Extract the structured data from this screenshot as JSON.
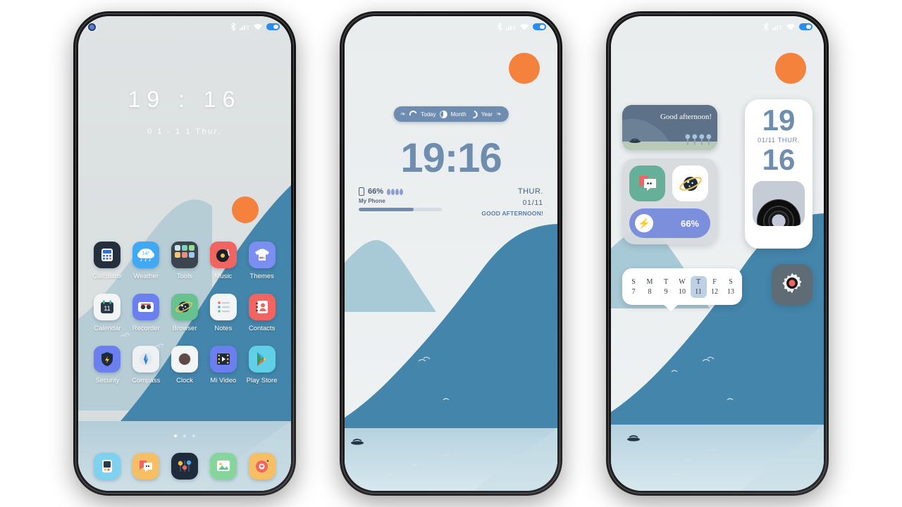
{
  "theme": {
    "accent_orange": "#f4813c",
    "mountain_dark": "#4485ab",
    "mountain_light": "#a8c9d6",
    "water": "#bcd5e0",
    "sky": "#eceff0",
    "clock_blue": "#6f8dae"
  },
  "phone1": {
    "name": "home-screen",
    "statusbar": {
      "bluetooth": "bluetooth-icon",
      "signal": "signal-icon",
      "wifi": "wifi-icon",
      "battery": "battery-icon"
    },
    "clock": "19 : 16",
    "date": "0 1 - 1 1  Thur.",
    "apps": [
      {
        "label": "Calculator",
        "icon": "calculator-icon"
      },
      {
        "label": "Weather",
        "icon": "weather-icon",
        "badge": "14°"
      },
      {
        "label": "Tools",
        "icon": "tools-folder-icon"
      },
      {
        "label": "Music",
        "icon": "music-icon"
      },
      {
        "label": "Themes",
        "icon": "themes-icon"
      },
      {
        "label": "Calendar",
        "icon": "calendar-icon",
        "badge": "11"
      },
      {
        "label": "Recorder",
        "icon": "recorder-icon"
      },
      {
        "label": "Browser",
        "icon": "browser-icon"
      },
      {
        "label": "Notes",
        "icon": "notes-icon"
      },
      {
        "label": "Contacts",
        "icon": "contacts-icon"
      },
      {
        "label": "Security",
        "icon": "security-icon"
      },
      {
        "label": "Compass",
        "icon": "compass-icon"
      },
      {
        "label": "Clock",
        "icon": "clock-icon"
      },
      {
        "label": "Mi Video",
        "icon": "mi-video-icon"
      },
      {
        "label": "Play Store",
        "icon": "play-store-icon"
      }
    ],
    "page_indicator": {
      "pages": 3,
      "active": 1
    },
    "dock": [
      {
        "name": "phone-manager-icon"
      },
      {
        "name": "messages-icon"
      },
      {
        "name": "settings-dock-icon"
      },
      {
        "name": "gallery-icon"
      },
      {
        "name": "camera-icon"
      }
    ]
  },
  "phone2": {
    "name": "lock-screen",
    "pill": {
      "today": "Today",
      "month": "Month",
      "year": "Year"
    },
    "clock": "19:16",
    "battery_percent": "66%",
    "device_label": "My Phone",
    "battery_fill": 66,
    "weekday": "THUR.",
    "date": "01/11",
    "greeting": "GOOD AFTERNOON!"
  },
  "phone3": {
    "name": "widget-screen",
    "greeting_widget": {
      "text": "Good afternoon!"
    },
    "clock_widget": {
      "hours": "19",
      "date": "01/11  THUR.",
      "minutes": "16",
      "vinyl": "vinyl-record-icon"
    },
    "app_widget": {
      "tiles": [
        {
          "name": "messages-tile-icon"
        },
        {
          "name": "browser-tile-icon"
        }
      ],
      "battery": {
        "percent": "66%",
        "icon": "bolt-icon"
      }
    },
    "calendar_widget": {
      "days": [
        "S",
        "M",
        "T",
        "W",
        "T",
        "F",
        "S"
      ],
      "dates": [
        "7",
        "8",
        "9",
        "10",
        "11",
        "12",
        "13"
      ],
      "selected_index": 4
    },
    "settings_widget": {
      "icon": "gear-icon"
    }
  }
}
